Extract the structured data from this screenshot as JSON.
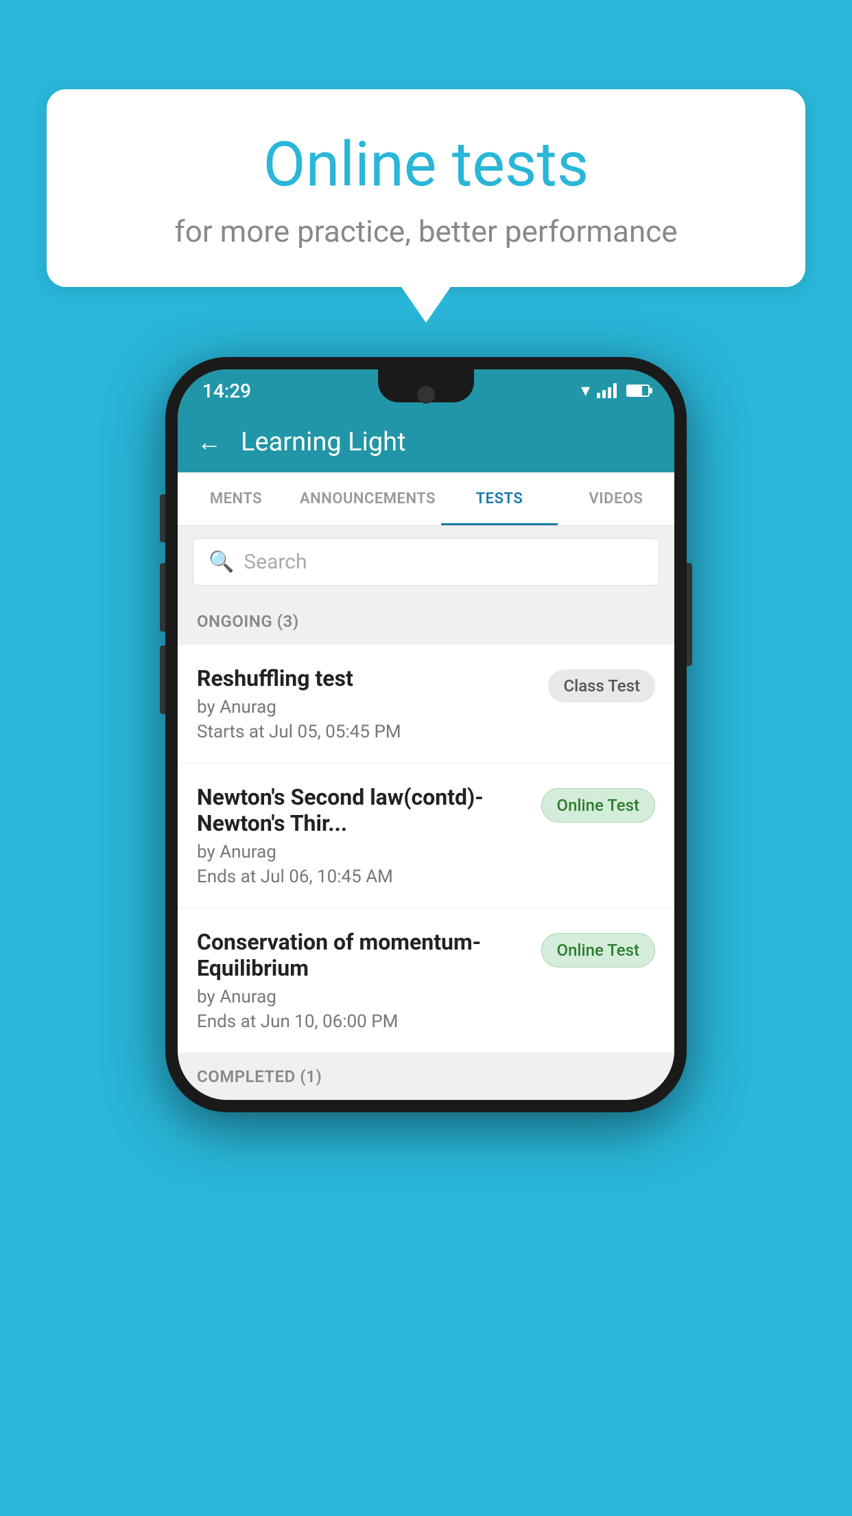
{
  "background_color": "#29b6d8",
  "speech_bubble": {
    "title": "Online tests",
    "subtitle": "for more practice, better performance"
  },
  "phone": {
    "status_bar": {
      "time": "14:29"
    },
    "app_header": {
      "title": "Learning Light",
      "back_label": "←"
    },
    "tabs": [
      {
        "label": "MENTS",
        "active": false
      },
      {
        "label": "ANNOUNCEMENTS",
        "active": false
      },
      {
        "label": "TESTS",
        "active": true
      },
      {
        "label": "VIDEOS",
        "active": false
      }
    ],
    "search": {
      "placeholder": "Search"
    },
    "ongoing_section": {
      "header": "ONGOING (3)",
      "tests": [
        {
          "name": "Reshuffling test",
          "author": "by Anurag",
          "date": "Starts at  Jul 05, 05:45 PM",
          "badge": "Class Test",
          "badge_type": "class"
        },
        {
          "name": "Newton's Second law(contd)-Newton's Thir...",
          "author": "by Anurag",
          "date": "Ends at  Jul 06, 10:45 AM",
          "badge": "Online Test",
          "badge_type": "online"
        },
        {
          "name": "Conservation of momentum-Equilibrium",
          "author": "by Anurag",
          "date": "Ends at  Jun 10, 06:00 PM",
          "badge": "Online Test",
          "badge_type": "online"
        }
      ]
    },
    "completed_section": {
      "header": "COMPLETED (1)"
    }
  }
}
